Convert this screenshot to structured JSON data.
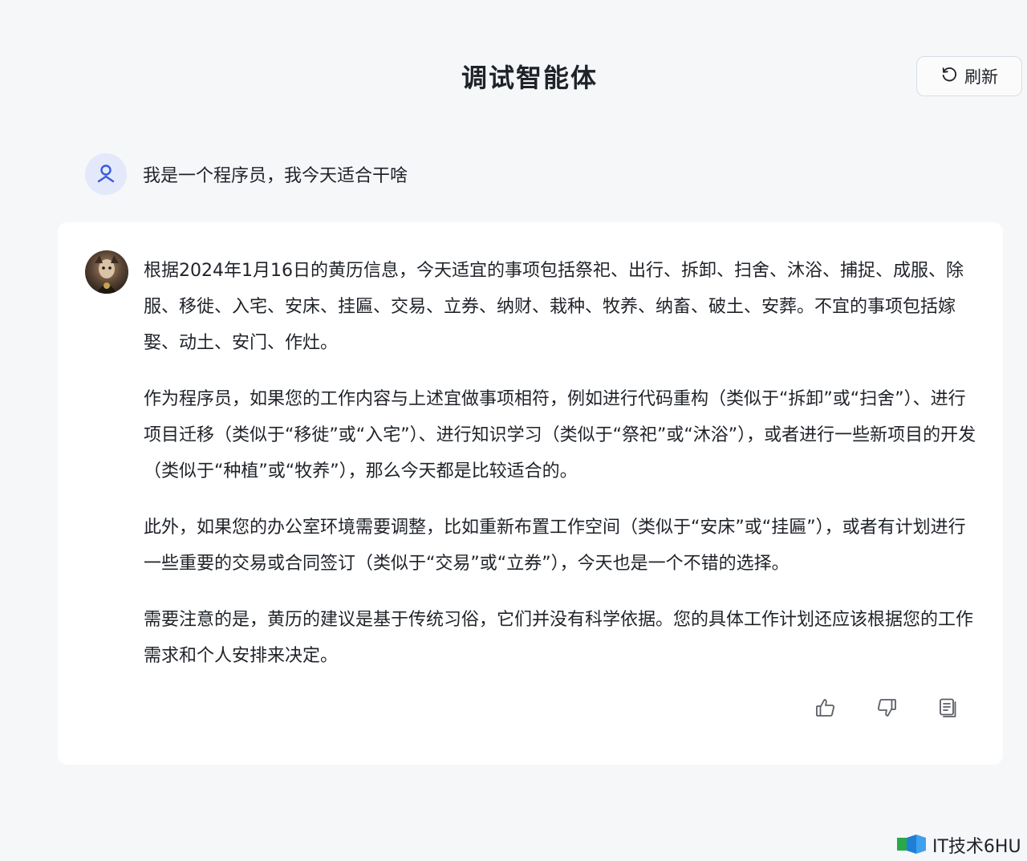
{
  "header": {
    "title": "调试智能体",
    "refresh_label": "刷新"
  },
  "user_message": {
    "text": "我是一个程序员，我今天适合干啥"
  },
  "answer": {
    "paragraphs": [
      "根据2024年1月16日的黄历信息，今天适宜的事项包括祭祀、出行、拆卸、扫舍、沐浴、捕捉、成服、除服、移徙、入宅、安床、挂匾、交易、立券、纳财、栽种、牧养、纳畜、破土、安葬。不宜的事项包括嫁娶、动土、安门、作灶。",
      "作为程序员，如果您的工作内容与上述宜做事项相符，例如进行代码重构（类似于“拆卸”或“扫舍”）、进行项目迁移（类似于“移徙”或“入宅”）、进行知识学习（类似于“祭祀”或“沐浴”），或者进行一些新项目的开发（类似于“种植”或“牧养”），那么今天都是比较适合的。",
      "此外，如果您的办公室环境需要调整，比如重新布置工作空间（类似于“安床”或“挂匾”），或者有计划进行一些重要的交易或合同签订（类似于“交易”或“立券”），今天也是一个不错的选择。",
      "需要注意的是，黄历的建议是基于传统习俗，它们并没有科学依据。您的具体工作计划还应该根据您的工作需求和个人安排来决定。"
    ],
    "actions": [
      "thumbs-up-icon",
      "thumbs-down-icon",
      "copy-icon"
    ]
  },
  "watermark": {
    "text": "IT技术6HU"
  },
  "colors": {
    "background": "#f6f7f9",
    "card": "#ffffff",
    "text": "#1f2329",
    "user_avatar_bg": "#e3e9fb",
    "user_avatar_icon": "#3a5bd9"
  }
}
